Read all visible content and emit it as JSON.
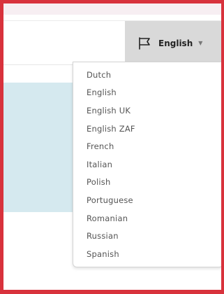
{
  "header": {
    "language_button": {
      "label": "English",
      "icon": "flag-icon",
      "caret_icon": "chevron-down-icon"
    }
  },
  "language_menu": {
    "items": [
      "Dutch",
      "English",
      "English UK",
      "English ZAF",
      "French",
      "Italian",
      "Polish",
      "Portuguese",
      "Romanian",
      "Russian",
      "Spanish"
    ]
  },
  "colors": {
    "frame_border": "#d8323c",
    "button_bg": "#d9d9d9",
    "panel_bg": "#d5e9ef"
  }
}
